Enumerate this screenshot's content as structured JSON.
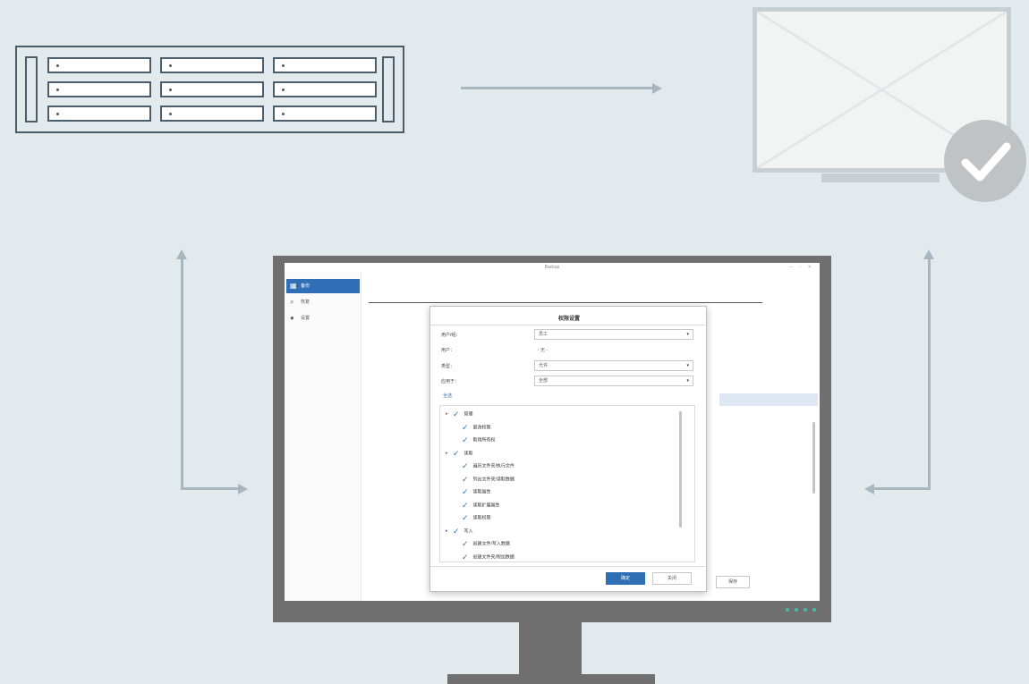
{
  "server": {
    "drive_rows": 3,
    "drive_cols": 3
  },
  "colors": {
    "background": "#e3eaee",
    "rack_stroke": "#4b5c6a",
    "arrow": "#a8b6bf",
    "monitor_frame": "#6f6f6f",
    "accent_blue": "#2f6fb6",
    "check_badge": "#c0c3c5",
    "status_led": "#4db6a6"
  },
  "target_monitor": {
    "status_icon": "check-icon"
  },
  "app": {
    "window_title": "Backup",
    "sidebar": [
      {
        "label": "备份",
        "icon": "grid-icon",
        "active": true
      },
      {
        "label": "恢复",
        "icon": "search-icon",
        "active": false
      },
      {
        "label": "设置",
        "icon": "settings-icon",
        "active": false
      }
    ],
    "dialog": {
      "title": "权限设置",
      "fields": [
        {
          "label": "用户/组：",
          "value": "员工",
          "dropdown": true
        },
        {
          "label": "用户：",
          "value": "- 无 -",
          "dropdown": false
        },
        {
          "label": "类型：",
          "value": "允许",
          "dropdown": true
        },
        {
          "label": "应用于：",
          "value": "全部",
          "dropdown": true
        }
      ],
      "link": "全选",
      "tree": [
        {
          "label": "管理",
          "level": 0,
          "expanded": true
        },
        {
          "label": "更改权限",
          "level": 1
        },
        {
          "label": "取得所有权",
          "level": 1
        },
        {
          "label": "读取",
          "level": 0,
          "expanded": true
        },
        {
          "label": "遍历文件夹/执行文件",
          "level": 1
        },
        {
          "label": "列出文件夹/读取数据",
          "level": 1
        },
        {
          "label": "读取属性",
          "level": 1
        },
        {
          "label": "读取扩展属性",
          "level": 1
        },
        {
          "label": "读取权限",
          "level": 1
        },
        {
          "label": "写入",
          "level": 0,
          "expanded": true
        },
        {
          "label": "创建文件/写入数据",
          "level": 1
        },
        {
          "label": "创建文件夹/附加数据",
          "level": 1
        }
      ],
      "ok_label": "确定",
      "cancel_label": "关闭"
    },
    "background_button": "保存"
  }
}
